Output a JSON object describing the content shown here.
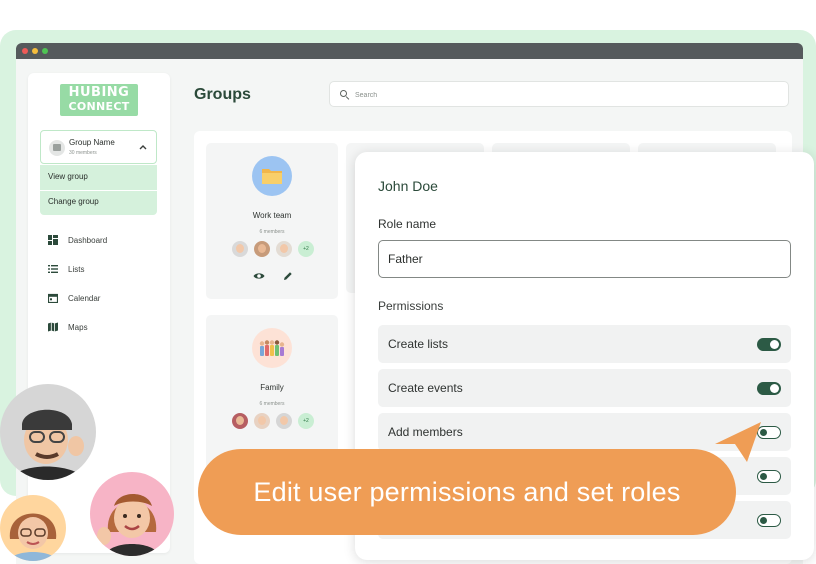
{
  "window": {
    "controls": [
      "close",
      "minimize",
      "maximize"
    ]
  },
  "sidebar": {
    "logo": {
      "line1": "HUBING",
      "line2": "CONNECT"
    },
    "group_selector": {
      "name": "Group Name",
      "count": "30 members",
      "chevron_icon": "chevron-up-icon"
    },
    "group_menu": [
      {
        "label": "View group"
      },
      {
        "label": "Change group"
      }
    ],
    "nav": [
      {
        "label": "Dashboard",
        "icon": "dashboard-icon"
      },
      {
        "label": "Lists",
        "icon": "list-icon"
      },
      {
        "label": "Calendar",
        "icon": "calendar-icon"
      },
      {
        "label": "Maps",
        "icon": "map-icon"
      }
    ]
  },
  "header": {
    "title": "Groups",
    "search": {
      "placeholder": "Search",
      "icon": "search-icon"
    }
  },
  "groups": [
    {
      "title": "Work team",
      "count": "6 members",
      "extra_members": "+2",
      "icon": "folder-icon"
    },
    {
      "title": "Family",
      "count": "6 members",
      "extra_members": "+2",
      "icon": "family-illustration"
    }
  ],
  "role_panel": {
    "user_name": "John Doe",
    "role_name_label": "Role name",
    "role_name_value": "Father",
    "permissions_label": "Permissions",
    "permissions": [
      {
        "label": "Create lists",
        "enabled": true
      },
      {
        "label": "Create events",
        "enabled": true
      },
      {
        "label": "Add members",
        "enabled": false
      },
      {
        "label": "",
        "enabled": false
      },
      {
        "label": "",
        "enabled": false
      }
    ]
  },
  "caption": {
    "text": "Edit user permissions and set roles"
  },
  "colors": {
    "brand_green": "#97dba5",
    "backdrop": "#d9f3e0",
    "title_green": "#2b4a3a",
    "toggle_green": "#2c5a45",
    "caption_orange": "#ef9d55"
  }
}
